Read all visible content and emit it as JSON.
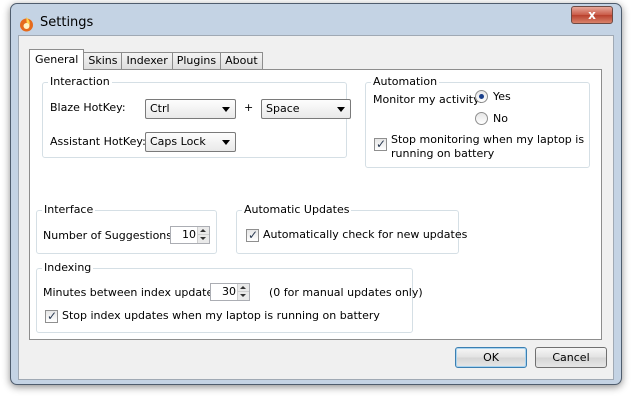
{
  "window": {
    "title": "Settings",
    "close_label": "x",
    "icon": "blaze-app-icon"
  },
  "tabs": [
    {
      "label": "General",
      "active": true
    },
    {
      "label": "Skins"
    },
    {
      "label": "Indexer"
    },
    {
      "label": "Plugins"
    },
    {
      "label": "About"
    }
  ],
  "interaction": {
    "title": "Interaction",
    "blaze_hotkey_label": "Blaze HotKey:",
    "blaze_hotkey_modifier": "Ctrl",
    "plus": "+",
    "blaze_hotkey_key": "Space",
    "assistant_hotkey_label": "Assistant HotKey:",
    "assistant_hotkey_value": "Caps Lock"
  },
  "automation": {
    "title": "Automation",
    "monitor_label": "Monitor my activity:",
    "yes_label": "Yes",
    "no_label": "No",
    "selected": "Yes",
    "stop_monitoring_label": "Stop monitoring when my laptop is running on battery",
    "stop_monitoring_checked": true
  },
  "interface": {
    "title": "Interface",
    "suggestions_label": "Number of Suggestions:",
    "suggestions_value": "10"
  },
  "automatic_updates": {
    "title": "Automatic Updates",
    "auto_check_label": "Automatically check for new updates",
    "auto_check_checked": true
  },
  "indexing": {
    "title": "Indexing",
    "minutes_label": "Minutes between index updates:",
    "minutes_value": "30",
    "minutes_hint": "(0 for manual updates only)",
    "stop_index_label": "Stop index updates when my laptop is running on battery",
    "stop_index_checked": true
  },
  "buttons": {
    "ok": "OK",
    "cancel": "Cancel"
  },
  "colors": {
    "frame": "#c4d3e4",
    "accent": "#3c7fb1",
    "close": "#c95a47"
  }
}
